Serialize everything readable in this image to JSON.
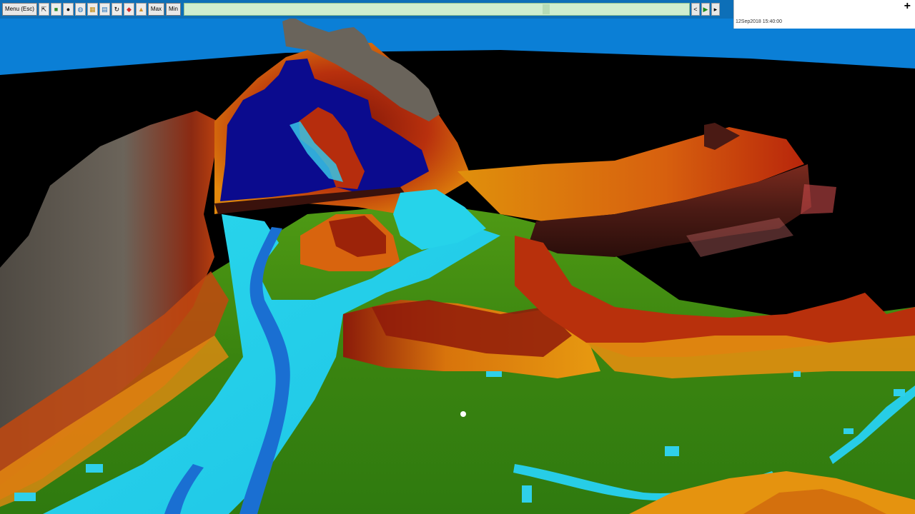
{
  "toolbar": {
    "menu_label": "Menu (Esc)",
    "max_label": "Max",
    "min_label": "Min",
    "tool_icons": [
      "pointer-icon",
      "layer-icon",
      "camera-icon",
      "globe-icon",
      "grid-icon",
      "map-icon",
      "rotate-icon",
      "palette-icon",
      "chart-icon"
    ],
    "time_slider": {
      "position": 0.72,
      "color": "#cfeecf"
    },
    "nav_prev": "<",
    "nav_play": "▶",
    "nav_next": "▸"
  },
  "info_panel": {
    "timestamp": "12Sep2018 15:40:00",
    "add_icon": "+"
  },
  "scene": {
    "description_colors": {
      "sky": "#0b7fd6",
      "void": "#000000",
      "deep_water": "#0a0a8c",
      "shallow_water": "#22d3e8",
      "lowland": "#3f8a12",
      "midland": "#e08a0a",
      "highland": "#8e1b0b",
      "rock": "#5e584f"
    }
  }
}
